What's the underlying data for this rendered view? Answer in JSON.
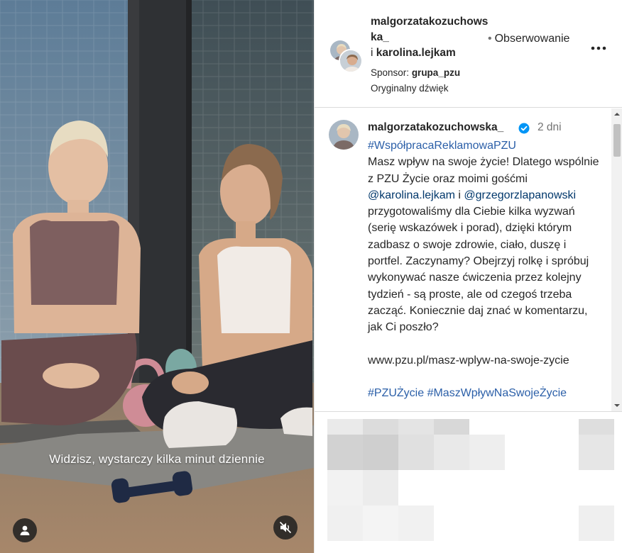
{
  "video": {
    "subtitle": "Widzisz, wystarczy kilka minut dziennie",
    "icons": {
      "user_tag": "person-icon",
      "mute": "speaker-muted-icon"
    }
  },
  "header": {
    "author_primary": "malgorzatakozuchowska_",
    "connector": "i",
    "author_secondary": "karolina.lejkam",
    "follow_status": "Obserwowanie",
    "sponsor_label": "Sponsor:",
    "sponsor_name": "grupa_pzu",
    "audio": "Oryginalny dźwięk",
    "icons": {
      "more": "more-horizontal-icon"
    }
  },
  "caption": {
    "username": "malgorzatakozuchowska_",
    "time_ago": "2 dni",
    "hashtag_top": "#WspółpracaReklamowaPZU",
    "text_1": "Masz wpływ na swoje życie! Dlatego wspólnie z PZU Życie oraz moimi gośćmi ",
    "mention_1": "@karolina.lejkam",
    "text_2": " i ",
    "mention_2": "@grzegorzlapanowski",
    "text_3": " przygotowaliśmy dla Ciebie kilka wyzwań (serię wskazówek i porad), dzięki którym zadbasz o swoje zdrowie, ciało, duszę i portfel. Zaczynamy? Obejrzyj rolkę i spróbuj wykonywać nasze ćwiczenia przez kolejny tydzień - są proste, ale od czegoś trzeba zacząć. Koniecznie daj znać w komentarzu, jak Ci poszło?",
    "url": "www.pzu.pl/masz-wplyw-na-swoje-zycie",
    "hashtags_bottom": "#PZUŻycie #MaszWpływNaSwojeŻycie",
    "icons": {
      "verified": "verified-badge-icon"
    }
  },
  "colors": {
    "link": "#00376b",
    "hashtag": "#2b5fa8",
    "secondary_text": "#737373",
    "verified": "#0095f6"
  }
}
